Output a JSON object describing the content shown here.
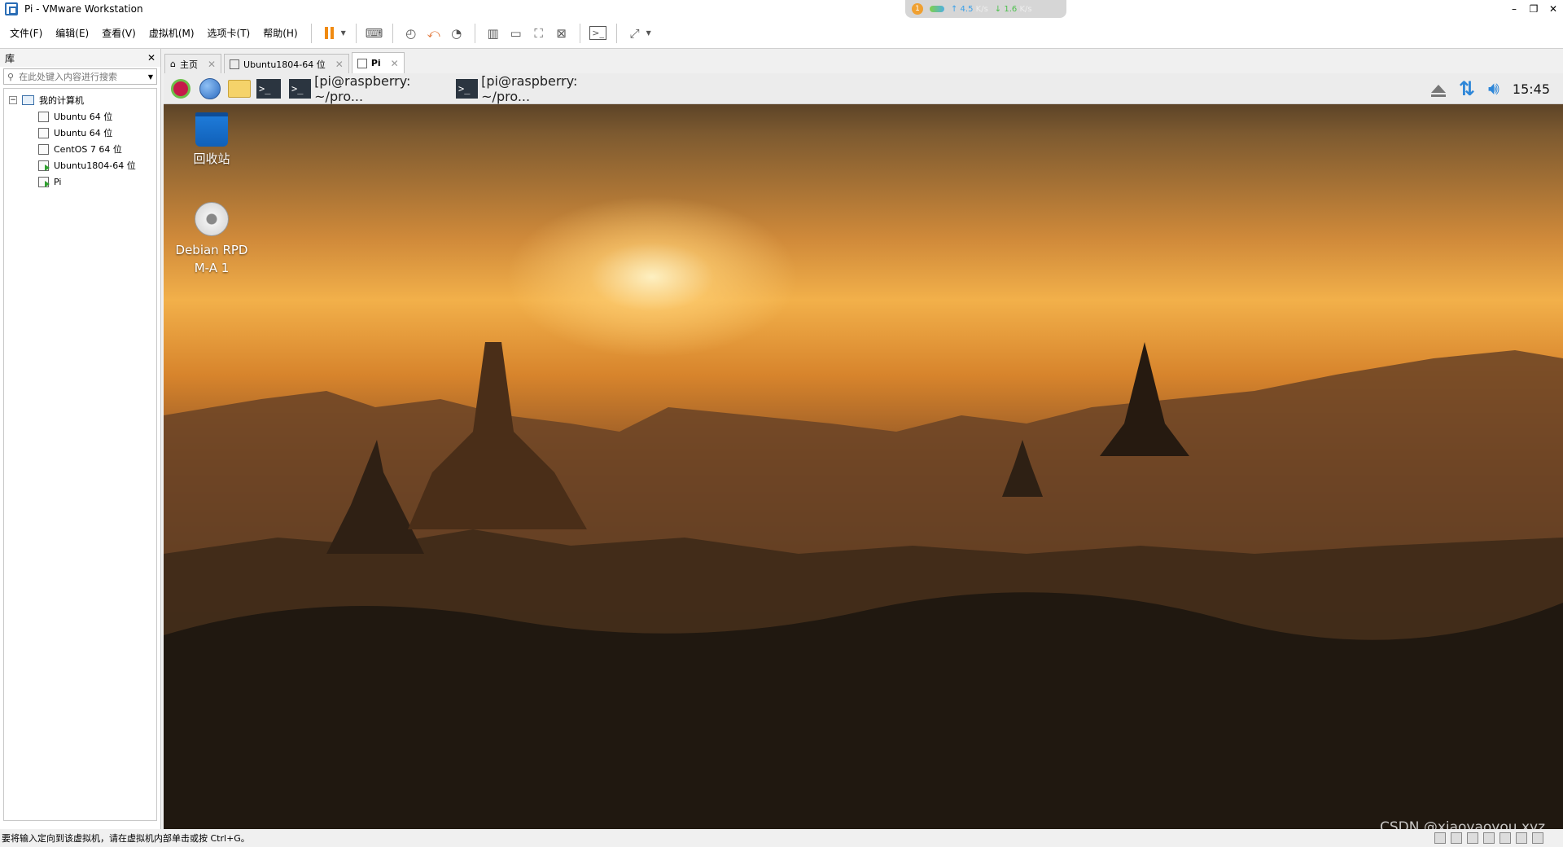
{
  "window": {
    "title": "Pi - VMware Workstation"
  },
  "net_widget": {
    "badge": "1",
    "up": "↑ 4.5",
    "up_unit": "K/s",
    "down": "↓ 1.6",
    "down_unit": "K/s"
  },
  "menu": {
    "items": [
      "文件(F)",
      "编辑(E)",
      "查看(V)",
      "虚拟机(M)",
      "选项卡(T)",
      "帮助(H)"
    ]
  },
  "library": {
    "title": "库",
    "search_placeholder": "在此处键入内容进行搜索",
    "root": "我的计算机",
    "vms": [
      "Ubuntu 64 位",
      "Ubuntu 64 位",
      "CentOS 7 64 位",
      "Ubuntu1804-64 位",
      "Pi"
    ]
  },
  "tabs": [
    {
      "label": "主页"
    },
    {
      "label": "Ubuntu1804-64 位"
    },
    {
      "label": "Pi"
    }
  ],
  "vm_panel": {
    "tasks": [
      "[pi@raspberry: ~/pro...",
      "[pi@raspberry: ~/pro..."
    ],
    "term_glyph": ">_",
    "clock": "15:45"
  },
  "desktop": {
    "trash_label": "回收站",
    "disc_label": "Debian RPD M-A 1"
  },
  "status": {
    "text": "要将输入定向到该虚拟机，请在虚拟机内部单击或按 Ctrl+G。"
  },
  "watermark": "CSDN @xiaoyaoyou.xyz"
}
